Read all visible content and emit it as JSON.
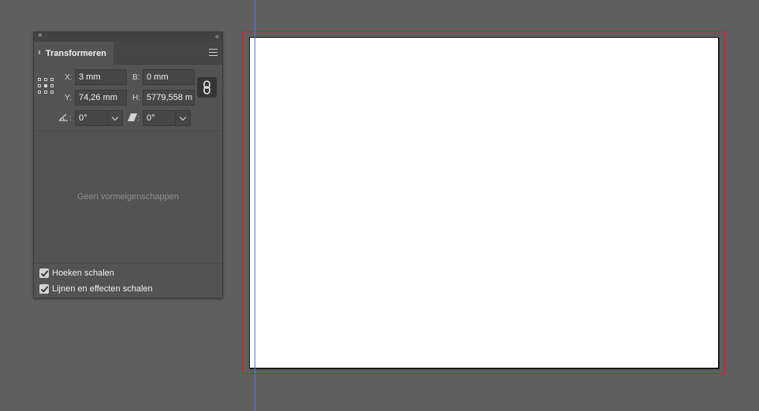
{
  "panel": {
    "title": "Transformeren",
    "close_glyph": "×",
    "collapse_glyph": "‹‹",
    "tab_arrows_glyph": "⬍",
    "fields": {
      "x": {
        "label": "X:",
        "value": "3 mm"
      },
      "y": {
        "label": "Y:",
        "value": "74,26 mm"
      },
      "b": {
        "label": "B:",
        "value": "0 mm"
      },
      "h": {
        "label": "H:",
        "value": "5779,558 m"
      },
      "rotate": {
        "label": ":",
        "value": "0°",
        "icon": "rotate-angle-icon"
      },
      "shear": {
        "label": ":",
        "value": "0°",
        "icon": "shear-icon"
      }
    },
    "placeholder": "Geen vormeigenschappen",
    "checkboxes": [
      {
        "label": "Hoeken schalen",
        "checked": true
      },
      {
        "label": "Lijnen en effecten schalen",
        "checked": true
      }
    ],
    "icons": {
      "reference_point": "reference-point-icon",
      "constrain": "link-chain-icon",
      "menu": "panel-menu-icon"
    }
  },
  "canvas": {
    "bleed_color": "#c3262e",
    "guide_color": "#4c7bf0",
    "page_color": "#ffffff",
    "background_color": "#5f5f5f"
  }
}
